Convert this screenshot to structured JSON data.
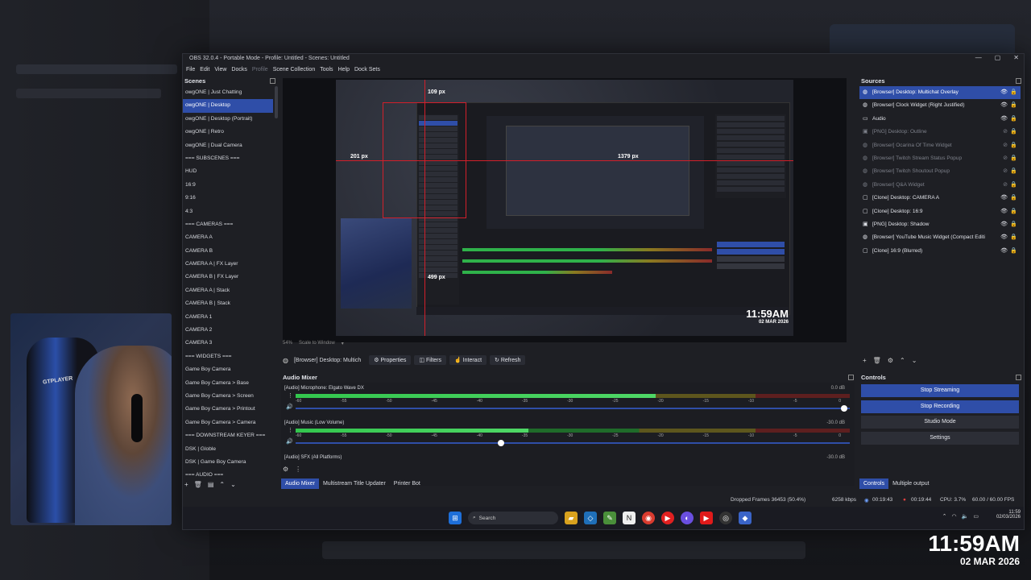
{
  "window": {
    "title": "OBS 32.0.4 - Portable Mode - Profile: Untitled - Scenes: Untitled"
  },
  "menu": [
    "File",
    "Edit",
    "View",
    "Docks",
    "Profile",
    "Scene Collection",
    "Tools",
    "Help",
    "Dock Sets"
  ],
  "scenes": {
    "header": "Scenes",
    "items": [
      "owgONE | Just Chatting",
      "owgONE | Desktop",
      "owgONE | Desktop (Portrait)",
      "owgONE | Retro",
      "owgONE | Dual Camera",
      "=== SUBSCENES ===",
      "HUD",
      "16:9",
      "9:16",
      "4:3",
      "=== CAMERAS ===",
      "CAMERA A",
      "CAMERA B",
      "CAMERA A | FX Layer",
      "CAMERA B | FX Layer",
      "CAMERA A | Stack",
      "CAMERA B | Stack",
      "CAMERA 1",
      "CAMERA 2",
      "CAMERA 3",
      "=== WIDGETS ===",
      "Game Boy Camera",
      "Game Boy Camera > Base",
      "Game Boy Camera > Screen",
      "Game Boy Camera > Printout",
      "Game Boy Camera > Camera",
      "=== DOWNSTREAM KEYER ===",
      "DSK | Globle",
      "DSK | Game Boy Camera",
      "=== AUDIO ==="
    ],
    "selected_index": 1
  },
  "preview": {
    "measurements": {
      "top": "109 px",
      "left": "201 px",
      "right": "1379 px",
      "bottom": "499 px"
    },
    "clock_time": "11:59AM",
    "clock_date": "02 MAR 2026",
    "zoom": "54%",
    "scale_mode": "Scale to Window"
  },
  "source_toolbar": {
    "source_name": "[Browser] Desktop: Multich",
    "properties": "Properties",
    "filters": "Filters",
    "interact": "Interact",
    "refresh": "Refresh"
  },
  "mixer": {
    "header": "Audio Mixer",
    "channels": [
      {
        "name": "[Audio] Microphone: Elgato Wave DX",
        "db": "0.0 dB",
        "level": 0.65,
        "volume": 0.99
      },
      {
        "name": "[Audio] Music (Low Volume)",
        "db": "-30.0 dB",
        "level": 0.42,
        "volume": 0.37
      },
      {
        "name": "[Audio] SFX (All Platforms)",
        "db": "-30.0 dB",
        "level": 0,
        "volume": 0
      }
    ],
    "ticks": [
      "-60",
      "-55",
      "-50",
      "-45",
      "-40",
      "-35",
      "-30",
      "-25",
      "-20",
      "-15",
      "-10",
      "-5",
      "0"
    ]
  },
  "bottom_tabs_left": [
    "Audio Mixer",
    "Multistream Title Updater",
    "Printer Bot"
  ],
  "sources": {
    "header": "Sources",
    "items": [
      {
        "name": "[Browser] Desktop: Multichat Overlay",
        "icon": "globe-icon",
        "visible": true
      },
      {
        "name": "[Browser] Clock Widget (Right Justified)",
        "icon": "globe-icon",
        "visible": true
      },
      {
        "name": "Audio",
        "icon": "folder-icon",
        "visible": true
      },
      {
        "name": "[PNG] Desktop: Outline",
        "icon": "image-icon",
        "visible": false
      },
      {
        "name": "[Browser] Ocarina Of Time Widget",
        "icon": "globe-icon",
        "visible": false
      },
      {
        "name": "[Browser] Twitch Stream Status Popup",
        "icon": "globe-icon",
        "visible": false
      },
      {
        "name": "[Browser] Twitch Shoutout Popup",
        "icon": "globe-icon",
        "visible": false
      },
      {
        "name": "[Browser] Q&A Widget",
        "icon": "globe-icon",
        "visible": false
      },
      {
        "name": "[Clone] Desktop: CAMERA A",
        "icon": "clone-icon",
        "visible": true
      },
      {
        "name": "[Clone] Desktop: 16:9",
        "icon": "clone-icon",
        "visible": true
      },
      {
        "name": "[PNG] Desktop: Shadow",
        "icon": "image-icon",
        "visible": true
      },
      {
        "name": "[Browser] YouTube Music Widget (Compact Editi",
        "icon": "globe-icon",
        "visible": true
      },
      {
        "name": "[Clone] 16:9 (Blurred)",
        "icon": "clone-icon",
        "visible": true
      }
    ]
  },
  "controls": {
    "header": "Controls",
    "stop_streaming": "Stop Streaming",
    "stop_recording": "Stop Recording",
    "studio_mode": "Studio Mode",
    "settings": "Settings"
  },
  "bottom_tabs_right": [
    "Controls",
    "Multiple output"
  ],
  "status": {
    "dropped": "Dropped Frames 36453 (50.4%)",
    "bitrate": "6258 kbps",
    "stream_time": "00:19:43",
    "rec_time": "00:19:44",
    "cpu": "CPU: 3.7%",
    "fps": "60.00 / 60.00 FPS"
  },
  "taskbar": {
    "search": "Search",
    "time": "11:59",
    "date": "02/03/2026"
  },
  "overlay_clock": {
    "time": "11:59AM",
    "date": "02 MAR 2026"
  },
  "webcam": {
    "chair_label": "GTPLAYER"
  },
  "colors": {
    "accent": "#2f4ea8",
    "measure_line": "#d21f2a",
    "meter_green": "#33c64e"
  }
}
